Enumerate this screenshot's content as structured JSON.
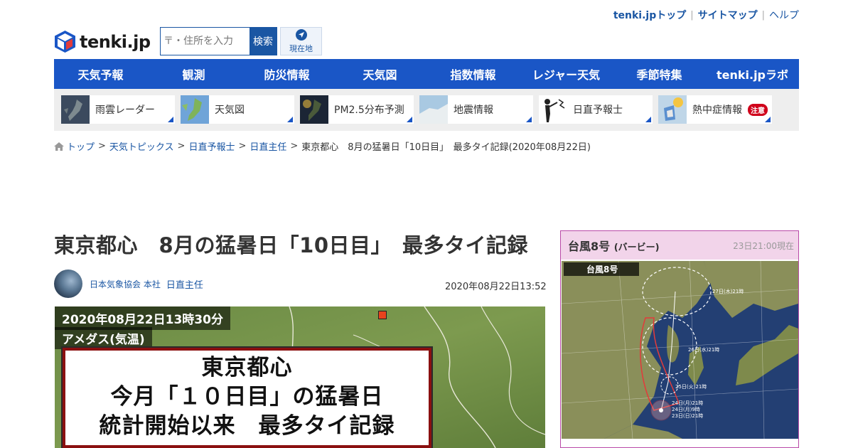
{
  "top_links": {
    "top": "tenki.jpトップ",
    "sitemap": "サイトマップ",
    "help": "ヘルプ"
  },
  "logo": {
    "text": "tenki.jp"
  },
  "search": {
    "placeholder": "〒・住所を入力",
    "button": "検索"
  },
  "location_button": {
    "label": "現在地"
  },
  "main_nav": [
    "天気予報",
    "観測",
    "防災情報",
    "天気図",
    "指数情報",
    "レジャー天気",
    "季節特集",
    "tenki.jpラボ"
  ],
  "quick_links": [
    {
      "label": "雨雲レーダー",
      "icon": "radar-thumb"
    },
    {
      "label": "天気図",
      "icon": "weather-map-thumb"
    },
    {
      "label": "PM2.5分布予測",
      "icon": "pm25-thumb"
    },
    {
      "label": "地震情報",
      "icon": "earthquake-thumb"
    },
    {
      "label": "日直予報士",
      "icon": "forecaster-thumb"
    },
    {
      "label": "熱中症情報",
      "icon": "heatstroke-thumb",
      "badge": "注意"
    }
  ],
  "breadcrumb": {
    "items": [
      "トップ",
      "天気トピックス",
      "日直予報士",
      "日直主任"
    ],
    "current": "東京都心　8月の猛暑日「10日目」　最多タイ記録(2020年08月22日)"
  },
  "article": {
    "title": "東京都心　8月の猛暑日「10日目」　最多タイ記録",
    "organization": "日本気象協会 本社",
    "author": "日直主任",
    "date": "2020年08月22日13:52",
    "image": {
      "timestamp": "2020年08月22日13時30分",
      "subtitle": "アメダス(気温)",
      "caption_lines": [
        "東京都心",
        "今月「１０日目」の猛暑日",
        "統計開始以来　最多タイ記録"
      ]
    }
  },
  "typhoon": {
    "title": "台風8号",
    "name": "(バービー)",
    "timestamp": "23日21:00現在",
    "map_label": "台風8号",
    "track_labels": [
      "27日(木)21時",
      "26日(水)21時",
      "25日(火)21時",
      "24日(月)21時",
      "24日(月)9時",
      "23日(日)21時"
    ]
  },
  "colors": {
    "brand_blue": "#1a56c6",
    "link_blue": "#1a56a3",
    "typhoon_header": "#f2d4ea",
    "alert_red": "#d0021b"
  }
}
